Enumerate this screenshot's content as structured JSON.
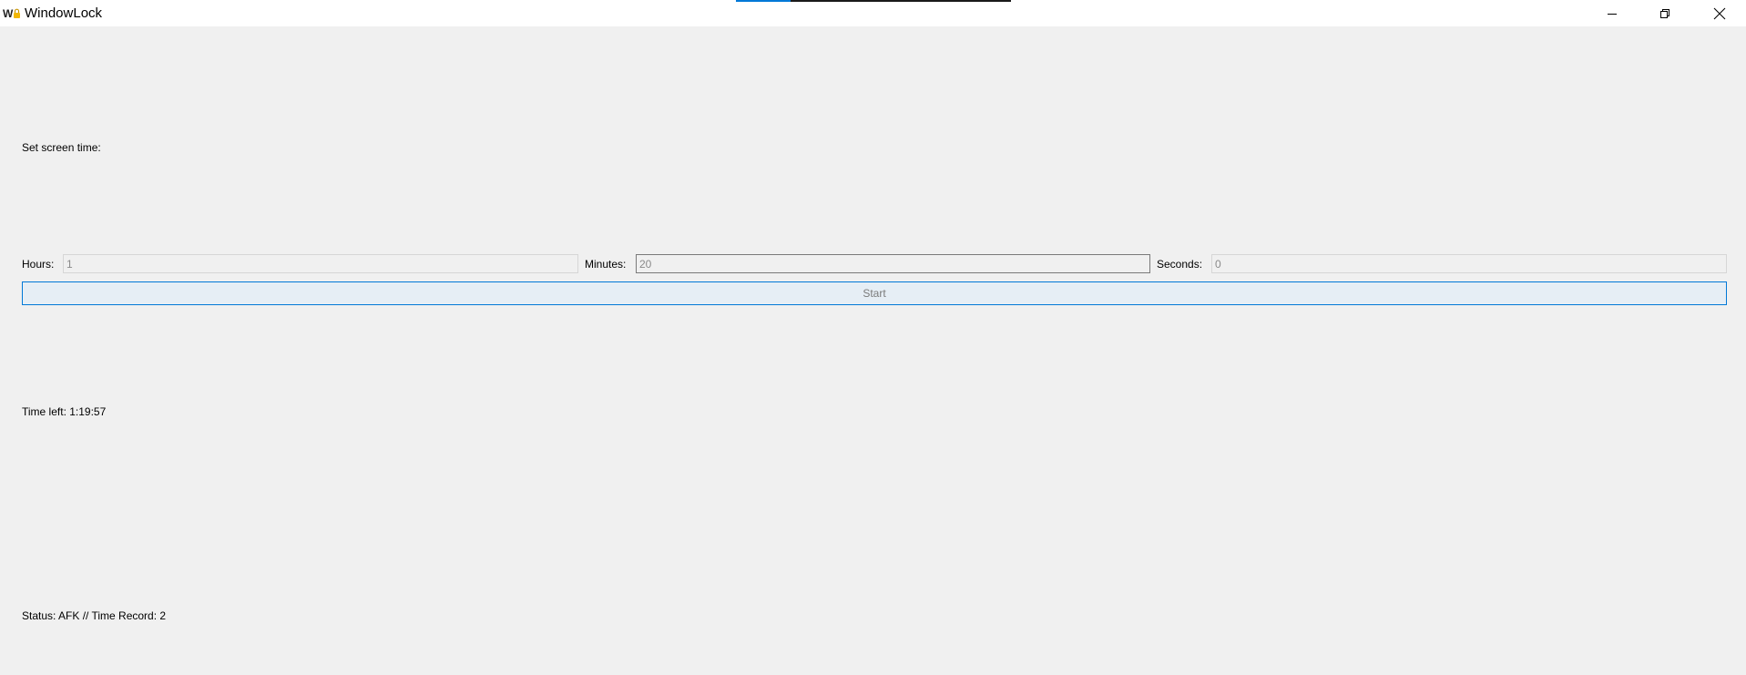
{
  "window": {
    "title": "WindowLock",
    "icon": "windowlock-app-icon",
    "controls": {
      "minimize_icon": "minimize-icon",
      "restore_icon": "restore-icon",
      "close_icon": "close-icon"
    }
  },
  "colors": {
    "background": "#f0f0f0",
    "titlebar": "#ffffff",
    "accent": "#0078d7",
    "disabled_text": "#8a8a8a"
  },
  "heading": {
    "set_screen_time": "Set screen time:"
  },
  "inputs": {
    "hours": {
      "label": "Hours:",
      "value": "1"
    },
    "minutes": {
      "label": "Minutes:",
      "value": "20"
    },
    "seconds": {
      "label": "Seconds:",
      "value": "0"
    }
  },
  "actions": {
    "start_label": "Start"
  },
  "status": {
    "time_left": "Time left: 1:19:57",
    "status_line": "Status: AFK // Time Record: 2"
  }
}
